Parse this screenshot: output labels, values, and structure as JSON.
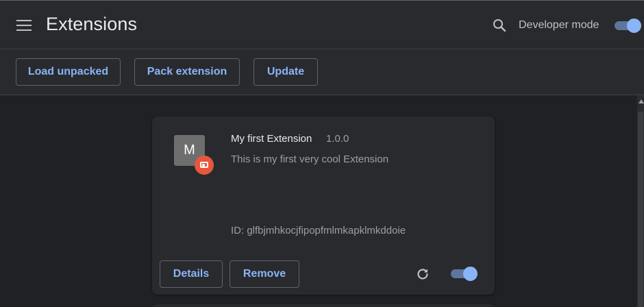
{
  "header": {
    "title": "Extensions",
    "menu_icon": "hamburger-menu-icon",
    "search_icon": "search-icon",
    "developer_mode_label": "Developer mode",
    "developer_mode_on": true
  },
  "toolbar": {
    "load_unpacked_label": "Load unpacked",
    "pack_extension_label": "Pack extension",
    "update_label": "Update"
  },
  "extensions": [
    {
      "avatar_letter": "M",
      "badge_icon": "unpacked-extension-icon",
      "name": "My first Extension",
      "version": "1.0.0",
      "description": "This is my first very cool Extension",
      "id_text": "ID: glfbjmhkocjfipopfmlmkapklmkddoie",
      "details_label": "Details",
      "remove_label": "Remove",
      "reload_icon": "reload-icon",
      "enabled": true
    }
  ],
  "colors": {
    "accent": "#8ab4f8",
    "background": "#202124",
    "surface": "#292a2d",
    "badge": "#e8573c"
  }
}
